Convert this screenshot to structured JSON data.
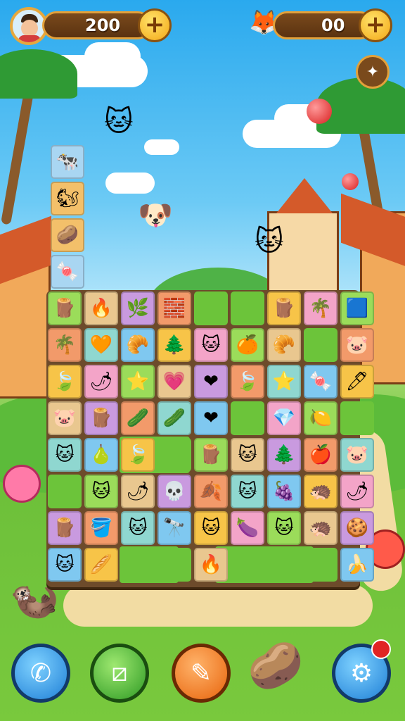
{
  "hud": {
    "coins": "200",
    "gems": "00",
    "coins_plus": "+",
    "gems_plus": "+"
  },
  "board": {
    "rows": [
      [
        "",
        "",
        "",
        "",
        "",
        "",
        "",
        "",
        ""
      ],
      [
        "🪵",
        "🔥",
        "🌿",
        "🧱",
        "",
        "",
        "🪵",
        "🌴",
        "🟦"
      ],
      [
        "🌴",
        "🧡",
        "🥐",
        "🌲",
        "🐱",
        "🍊",
        "🥐",
        "",
        "🐷"
      ],
      [
        "🍃",
        "🌶",
        "⭐",
        "💗",
        "❤",
        "🍃",
        "⭐",
        "🍬",
        "🖊"
      ],
      [
        "🐷",
        "🪵",
        "🥒",
        "🥒",
        "❤",
        "",
        "💎",
        "🍋",
        ""
      ],
      [
        "🐱",
        "🍐",
        "🍃",
        "",
        "🪵",
        "🐱",
        "🌲",
        "🍎",
        "🐷"
      ],
      [
        "",
        "🐱",
        "🌶",
        "💀",
        "🍂",
        "🐱",
        "🍇",
        "🦔",
        "🌶"
      ],
      [
        "🪵",
        "🪣",
        "🐱",
        "🔭",
        "🐱",
        "🍆",
        "🐱",
        "🦔",
        "🍪"
      ],
      [
        "🐱",
        "🥖",
        "",
        "",
        "🔥",
        "",
        "",
        "",
        "🍌"
      ]
    ],
    "tower": [
      "🐄",
      "🐿",
      "🥔",
      "🍬"
    ]
  },
  "buttons": {
    "left1": "phone",
    "left2": "shuffle",
    "center": "pencil",
    "right": "settings"
  },
  "colors": {
    "accent": "#f3a716",
    "bar": "#5a3210"
  }
}
